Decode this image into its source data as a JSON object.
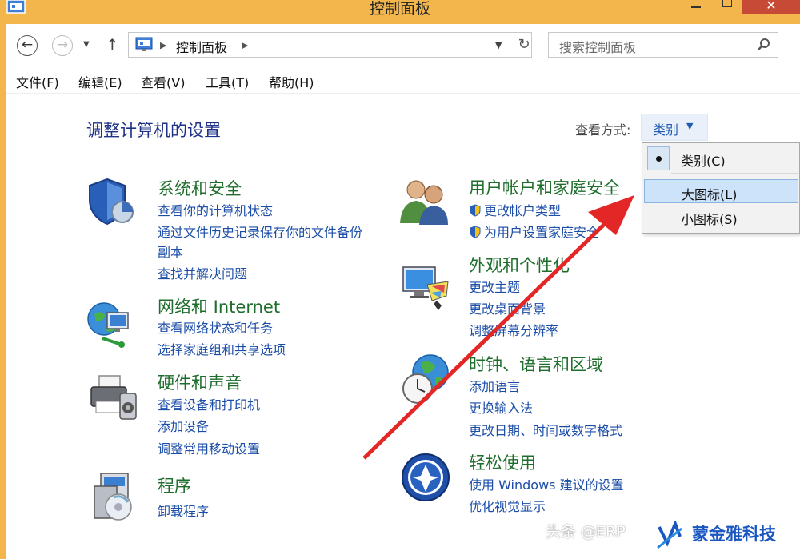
{
  "window": {
    "title": "控制面板"
  },
  "nav": {
    "breadcrumb": "控制面板",
    "search_placeholder": "搜索控制面板"
  },
  "menu": [
    "文件(F)",
    "编辑(E)",
    "查看(V)",
    "工具(T)",
    "帮助(H)"
  ],
  "page": {
    "heading": "调整计算机的设置",
    "view_by_label": "查看方式:",
    "view_by_value": "类别"
  },
  "dropdown": {
    "items": [
      "类别(C)",
      "大图标(L)",
      "小图标(S)"
    ],
    "selected": 0,
    "hovered": 1
  },
  "categories": [
    {
      "title": "系统和安全",
      "links": [
        "查看你的计算机状态",
        "通过文件历史记录保存你的文件备份",
        "副本",
        "查找并解决问题"
      ],
      "icon": "shield-icon"
    },
    {
      "title": "网络和 Internet",
      "links": [
        "查看网络状态和任务",
        "选择家庭组和共享选项"
      ],
      "icon": "network-icon"
    },
    {
      "title": "硬件和声音",
      "links": [
        "查看设备和打印机",
        "添加设备",
        "调整常用移动设置"
      ],
      "icon": "printer-icon"
    },
    {
      "title": "程序",
      "links": [
        "卸载程序"
      ],
      "icon": "programs-icon"
    },
    {
      "title": "用户帐户和家庭安全",
      "links": [
        "更改帐户类型",
        "为用户设置家庭安全"
      ],
      "icon": "users-icon"
    },
    {
      "title": "外观和个性化",
      "links": [
        "更改主题",
        "更改桌面背景",
        "调整屏幕分辨率"
      ],
      "icon": "appearance-icon"
    },
    {
      "title": "时钟、语言和区域",
      "links": [
        "添加语言",
        "更换输入法",
        "更改日期、时间或数字格式"
      ],
      "icon": "clock-globe-icon"
    },
    {
      "title": "轻松使用",
      "links": [
        "使用 Windows 建议的设置",
        "优化视觉显示"
      ],
      "icon": "ease-of-access-icon"
    }
  ],
  "watermark": {
    "text": "头条 @ERP",
    "brand": "蒙金雅科技"
  },
  "colors": {
    "title_bar": "#f2b64d",
    "category_title": "#1f6d2c",
    "link": "#1c4ea8",
    "heading": "#1e3287",
    "arrow": "#e32727"
  }
}
